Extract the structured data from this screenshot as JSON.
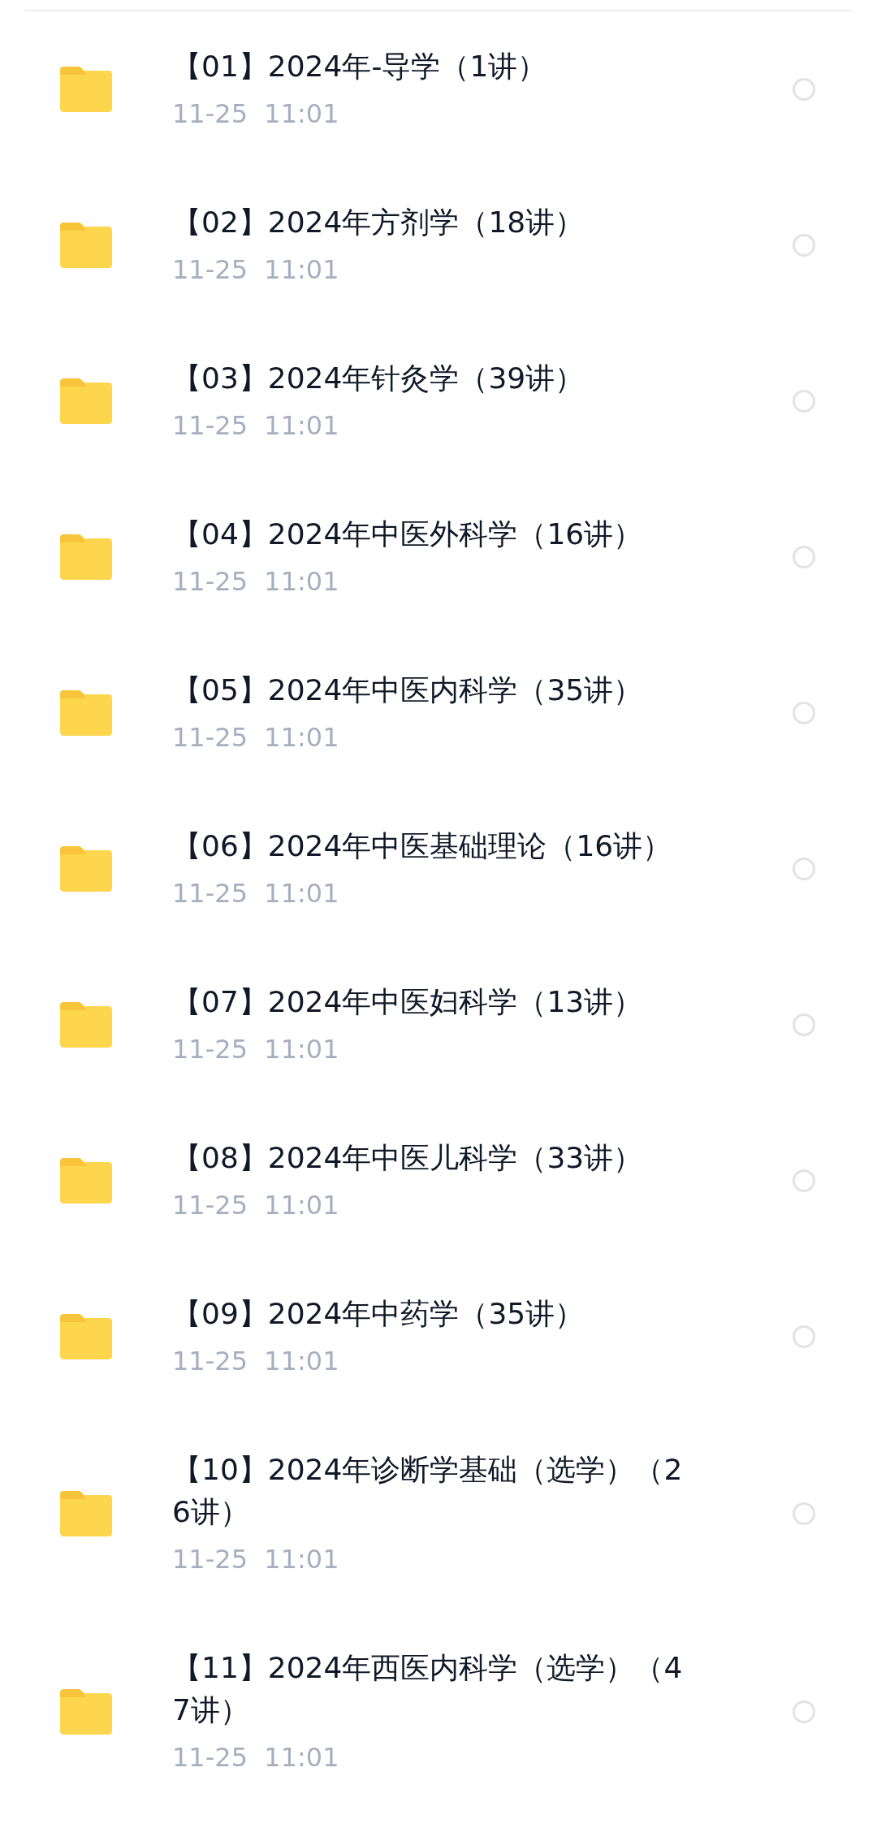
{
  "files": [
    {
      "title": "【01】2024年-导学（1讲）",
      "date": "11-25  11:01",
      "selected": false
    },
    {
      "title": "【02】2024年方剂学（18讲）",
      "date": "11-25  11:01",
      "selected": false
    },
    {
      "title": "【03】2024年针灸学（39讲）",
      "date": "11-25  11:01",
      "selected": false
    },
    {
      "title": "【04】2024年中医外科学（16讲）",
      "date": "11-25  11:01",
      "selected": false
    },
    {
      "title": "【05】2024年中医内科学（35讲）",
      "date": "11-25  11:01",
      "selected": false
    },
    {
      "title": "【06】2024年中医基础理论（16讲）",
      "date": "11-25  11:01",
      "selected": false
    },
    {
      "title": "【07】2024年中医妇科学（13讲）",
      "date": "11-25  11:01",
      "selected": false
    },
    {
      "title": "【08】2024年中医儿科学（33讲）",
      "date": "11-25  11:01",
      "selected": false
    },
    {
      "title": "【09】2024年中药学（35讲）",
      "date": "11-25  11:01",
      "selected": false
    },
    {
      "title": "【10】2024年诊断学基础（选学）（26讲）",
      "date": "11-25  11:01",
      "selected": false
    },
    {
      "title": "【11】2024年西医内科学（选学）（47讲）",
      "date": "11-25  11:01",
      "selected": false
    }
  ]
}
